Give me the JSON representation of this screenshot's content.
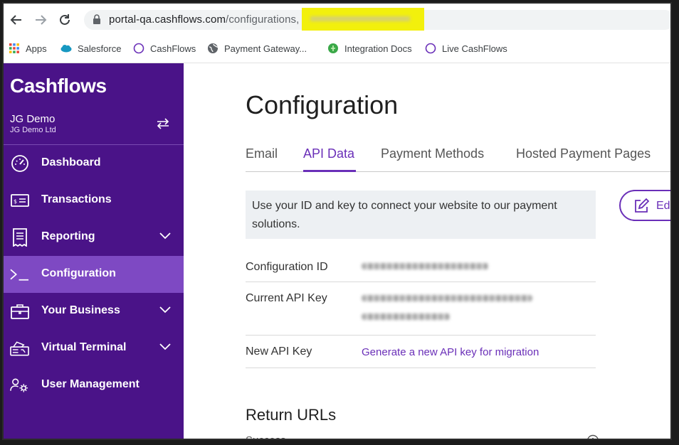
{
  "browser": {
    "url_host": "portal-qa.cashflows.com",
    "url_path": "/configurations,",
    "bookmarks": [
      {
        "label": "Apps",
        "icon": "apps-grid-icon"
      },
      {
        "label": "Salesforce",
        "icon": "salesforce-cloud-icon"
      },
      {
        "label": "CashFlows",
        "icon": "globe-outline-icon"
      },
      {
        "label": "Payment Gateway...",
        "icon": "globe-icon"
      },
      {
        "label": "Integration Docs",
        "icon": "integration-docs-icon"
      },
      {
        "label": "Live CashFlows",
        "icon": "globe-outline-icon"
      }
    ]
  },
  "sidebar": {
    "brand": "Cashflows",
    "account_name": "JG Demo",
    "account_sub": "JG Demo Ltd",
    "items": [
      {
        "label": "Dashboard",
        "icon": "dashboard-gauge-icon"
      },
      {
        "label": "Transactions",
        "icon": "transactions-card-icon"
      },
      {
        "label": "Reporting",
        "icon": "reporting-receipt-icon",
        "expandable": true
      },
      {
        "label": "Configuration",
        "icon": "terminal-prompt-icon",
        "active": true
      },
      {
        "label": "Your Business",
        "icon": "briefcase-icon",
        "expandable": true
      },
      {
        "label": "Virtual Terminal",
        "icon": "virtual-terminal-icon",
        "expandable": true
      },
      {
        "label": "User Management",
        "icon": "user-gear-icon"
      }
    ]
  },
  "main": {
    "title": "Configuration",
    "tabs": [
      "Email",
      "API Data",
      "Payment Methods",
      "Hosted Payment Pages"
    ],
    "active_tab": "API Data",
    "info_line1": "Use your ID and key to connect your website to our payment",
    "info_line2": "solutions.",
    "edit_label": "Ed",
    "rows": {
      "config_id_label": "Configuration ID",
      "api_key_label": "Current API Key",
      "new_key_label": "New API Key",
      "new_key_link": "Generate a new API key for migration"
    },
    "return_urls_title": "Return URLs",
    "success_label": "Success"
  },
  "colors": {
    "brand_purple": "#4a1388",
    "active_nav": "#7e49c3",
    "accent": "#6a2fb8",
    "redaction": "#f3f000"
  }
}
